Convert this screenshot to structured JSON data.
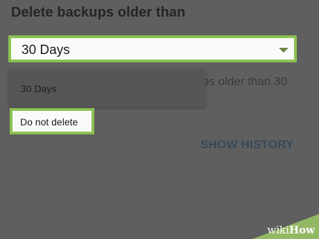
{
  "settings": {
    "section_title": "Delete backups older than",
    "select": {
      "value": "30 Days"
    },
    "background_description_line1": "ps older than 30",
    "background_description_line2": "."
  },
  "dropdown": {
    "items": [
      {
        "label": "30 Days"
      },
      {
        "label": "Do not delete"
      }
    ],
    "highlighted_color": "#8cc152"
  },
  "actions": {
    "show_history": "SHOW HISTORY"
  },
  "watermark": {
    "part1": "wiki",
    "part2": "How"
  },
  "colors": {
    "accent": "#8cc152",
    "overlay": "#5f5f5f",
    "link": "#38495a"
  }
}
